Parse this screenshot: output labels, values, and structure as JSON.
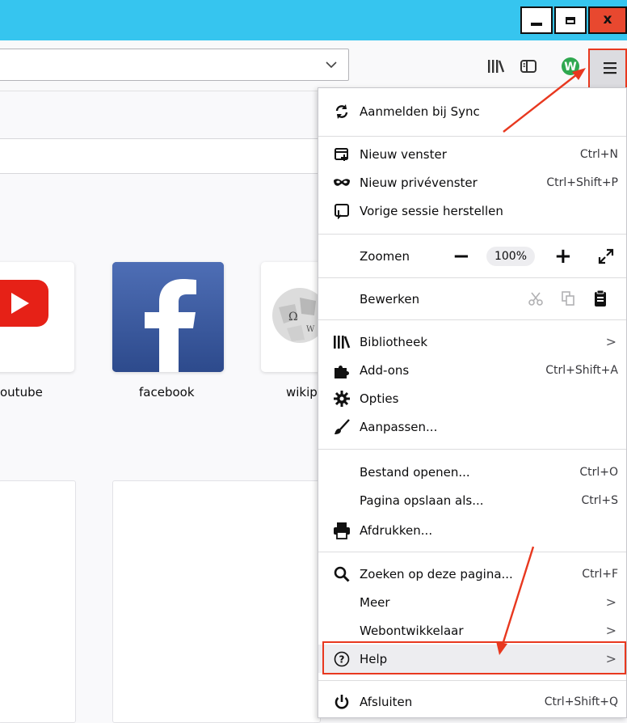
{
  "window": {
    "minimize": "_",
    "maximize": "□",
    "close": "x",
    "colors": {
      "titlebar": "#36c5ef",
      "close": "#e8482f"
    }
  },
  "toolbar": {
    "url_dropdown": "∨",
    "icons": [
      "library-icon",
      "sidebar-icon",
      "extension-w-icon",
      "hamburger-menu-icon"
    ],
    "extension_letter": "W"
  },
  "topsites": [
    {
      "label": "outube",
      "icon": "youtube-logo"
    },
    {
      "label": "facebook",
      "icon": "facebook-logo"
    },
    {
      "label": "wikip",
      "icon": "wikipedia-logo"
    }
  ],
  "menu": {
    "sync": {
      "label": "Aanmelden bij Sync",
      "icon": "sync-icon"
    },
    "new_window": {
      "label": "Nieuw venster",
      "shortcut": "Ctrl+N",
      "icon": "new-window-icon"
    },
    "private_window": {
      "label": "Nieuw privévenster",
      "shortcut": "Ctrl+Shift+P",
      "icon": "mask-icon"
    },
    "restore_session": {
      "label": "Vorige sessie herstellen",
      "icon": "restore-icon"
    },
    "zoom": {
      "label": "Zoomen",
      "minus": "−",
      "level": "100%",
      "plus": "+",
      "fullscreen_icon": "fullscreen-icon"
    },
    "edit": {
      "label": "Bewerken",
      "icons": [
        "cut-icon",
        "copy-icon",
        "paste-icon"
      ]
    },
    "library": {
      "label": "Bibliotheek",
      "arrow": ">",
      "icon": "library-icon"
    },
    "addons": {
      "label": "Add-ons",
      "shortcut": "Ctrl+Shift+A",
      "icon": "puzzle-icon"
    },
    "options": {
      "label": "Opties",
      "icon": "gear-icon"
    },
    "customize": {
      "label": "Aanpassen...",
      "icon": "brush-icon"
    },
    "open_file": {
      "label": "Bestand openen...",
      "shortcut": "Ctrl+O"
    },
    "save_page": {
      "label": "Pagina opslaan als...",
      "shortcut": "Ctrl+S"
    },
    "print": {
      "label": "Afdrukken...",
      "icon": "printer-icon"
    },
    "find": {
      "label": "Zoeken op deze pagina...",
      "shortcut": "Ctrl+F",
      "icon": "search-icon"
    },
    "more": {
      "label": "Meer",
      "arrow": ">"
    },
    "webdev": {
      "label": "Webontwikkelaar",
      "arrow": ">"
    },
    "help": {
      "label": "Help",
      "arrow": ">",
      "icon": "help-icon"
    },
    "quit": {
      "label": "Afsluiten",
      "shortcut": "Ctrl+Shift+Q",
      "icon": "power-icon"
    }
  },
  "annotation_color": "#e8381f"
}
